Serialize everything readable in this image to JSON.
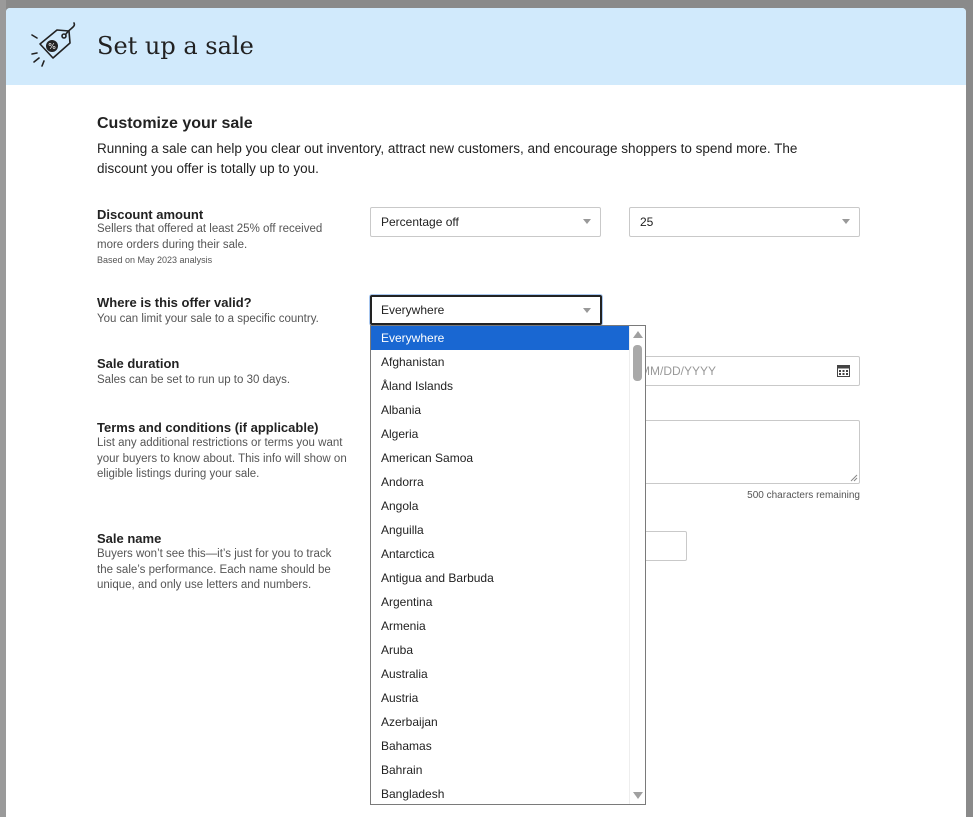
{
  "modal": {
    "title": "Set up a sale",
    "header_icon": "price-tag-icon"
  },
  "customize": {
    "title": "Customize your sale",
    "description": "Running a sale can help you clear out inventory, attract new customers, and encourage shoppers to spend more. The discount you offer is totally up to you."
  },
  "discount": {
    "label": "Discount amount",
    "help": "Sellers that offered at least 25% off received more orders during their sale.",
    "footnote": "Based on May 2023 analysis",
    "type_value": "Percentage off",
    "amount_value": "25"
  },
  "validity": {
    "label": "Where is this offer valid?",
    "help": "You can limit your sale to a specific country.",
    "value": "Everywhere"
  },
  "duration": {
    "label": "Sale duration",
    "help": "Sales can be set to run up to 30 days.",
    "end_date_placeholder": "MM/DD/YYYY",
    "calendar_icon": "calendar-icon"
  },
  "terms": {
    "label": "Terms and conditions (if applicable)",
    "help": "List any additional restrictions or terms you want your buyers to know about. This info will show on eligible listings during your sale.",
    "chars_remaining": "500 characters remaining"
  },
  "sale_name": {
    "label": "Sale name",
    "help": "Buyers won’t see this—it’s just for you to track the sale’s performance. Each name should be unique, and only use letters and numbers."
  },
  "dropdown": {
    "selected": "Everywhere",
    "options": [
      "Everywhere",
      "Afghanistan",
      "Åland Islands",
      "Albania",
      "Algeria",
      "American Samoa",
      "Andorra",
      "Angola",
      "Anguilla",
      "Antarctica",
      "Antigua and Barbuda",
      "Argentina",
      "Armenia",
      "Aruba",
      "Australia",
      "Austria",
      "Azerbaijan",
      "Bahamas",
      "Bahrain",
      "Bangladesh"
    ]
  },
  "colors": {
    "header_bg": "#d1eafc",
    "selected_option_bg": "#1967d2"
  }
}
